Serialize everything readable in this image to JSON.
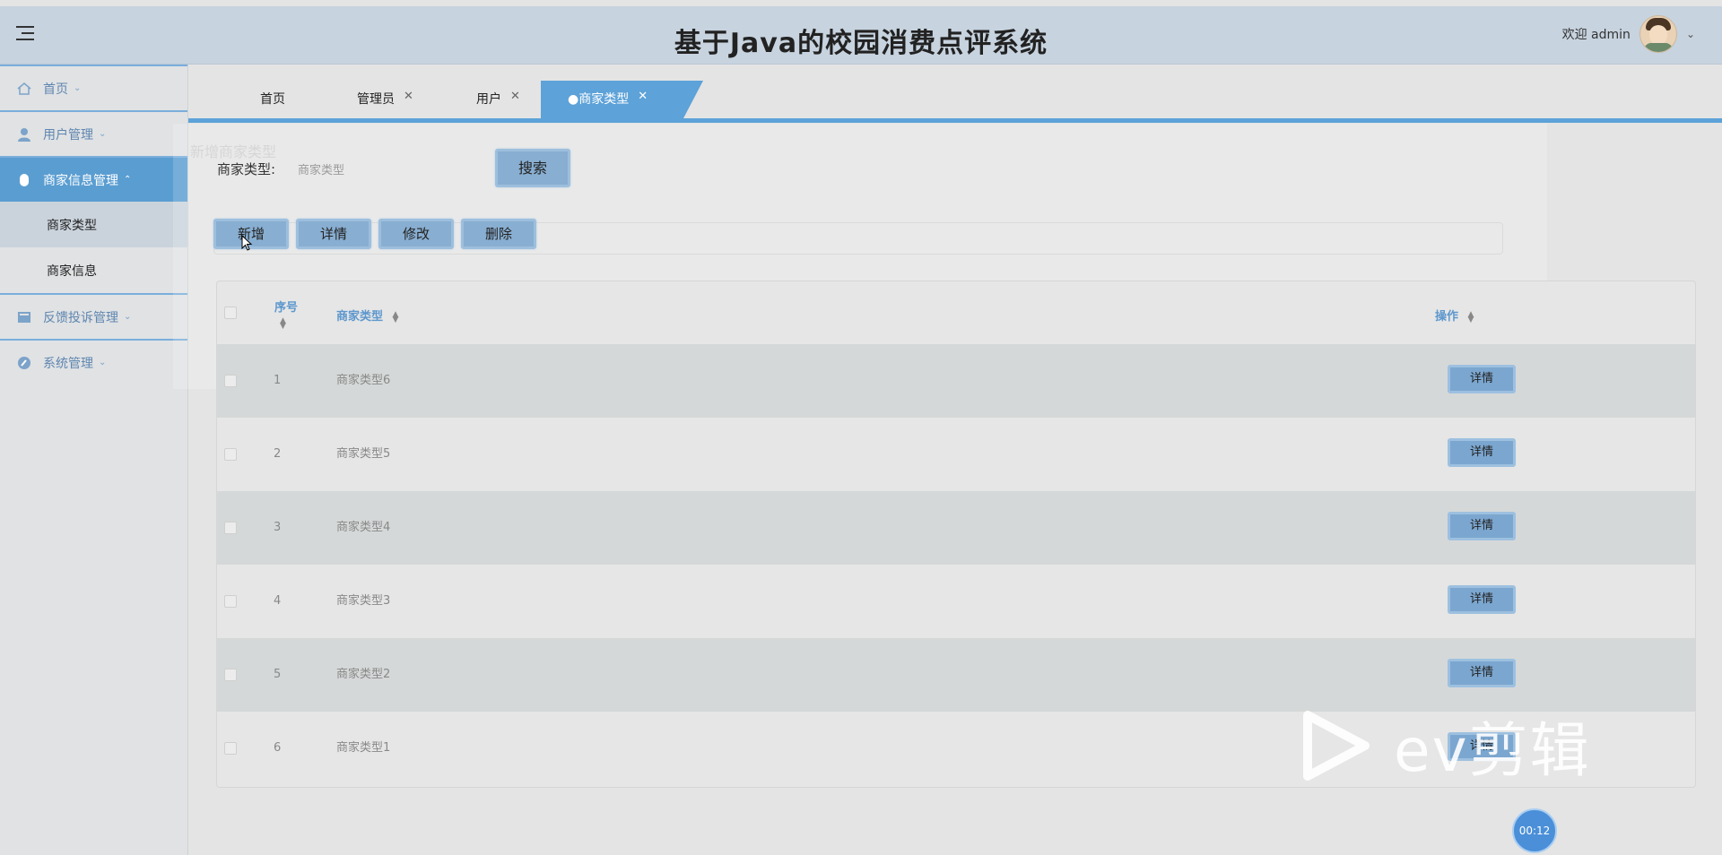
{
  "header": {
    "title": "基于Java的校园消费点评系统",
    "welcome": "欢迎 admin"
  },
  "sidebar": {
    "items": [
      {
        "label": "首页",
        "icon": "home-icon"
      },
      {
        "label": "用户管理",
        "icon": "user-icon"
      },
      {
        "label": "商家信息管理",
        "icon": "store-icon",
        "expanded": true,
        "children": [
          {
            "label": "商家类型",
            "active": true
          },
          {
            "label": "商家信息"
          }
        ]
      },
      {
        "label": "反馈投诉管理",
        "icon": "feedback-icon"
      },
      {
        "label": "系统管理",
        "icon": "settings-icon"
      }
    ]
  },
  "tabs": [
    {
      "label": "首页"
    },
    {
      "label": "管理员"
    },
    {
      "label": "用户"
    },
    {
      "label": "●商家类型",
      "active": true
    }
  ],
  "ghost_dialog": {
    "title": "新增商家类型"
  },
  "search": {
    "label": "商家类型:",
    "placeholder": "商家类型",
    "button": "搜索"
  },
  "actions": {
    "add": "新增",
    "detail": "详情",
    "edit": "修改",
    "delete": "删除"
  },
  "table": {
    "columns": {
      "index": "序号",
      "type": "商家类型",
      "action": "操作"
    },
    "row_button": "详情",
    "rows": [
      {
        "index": "1",
        "type": "商家类型6"
      },
      {
        "index": "2",
        "type": "商家类型5"
      },
      {
        "index": "3",
        "type": "商家类型4"
      },
      {
        "index": "4",
        "type": "商家类型3"
      },
      {
        "index": "5",
        "type": "商家类型2"
      },
      {
        "index": "6",
        "type": "商家类型1"
      }
    ]
  },
  "watermark": {
    "text": "ev剪辑"
  },
  "timer": "00:12",
  "colors": {
    "accent": "#5da2d8",
    "button": "#88aed1",
    "header": "#c7d3df"
  }
}
